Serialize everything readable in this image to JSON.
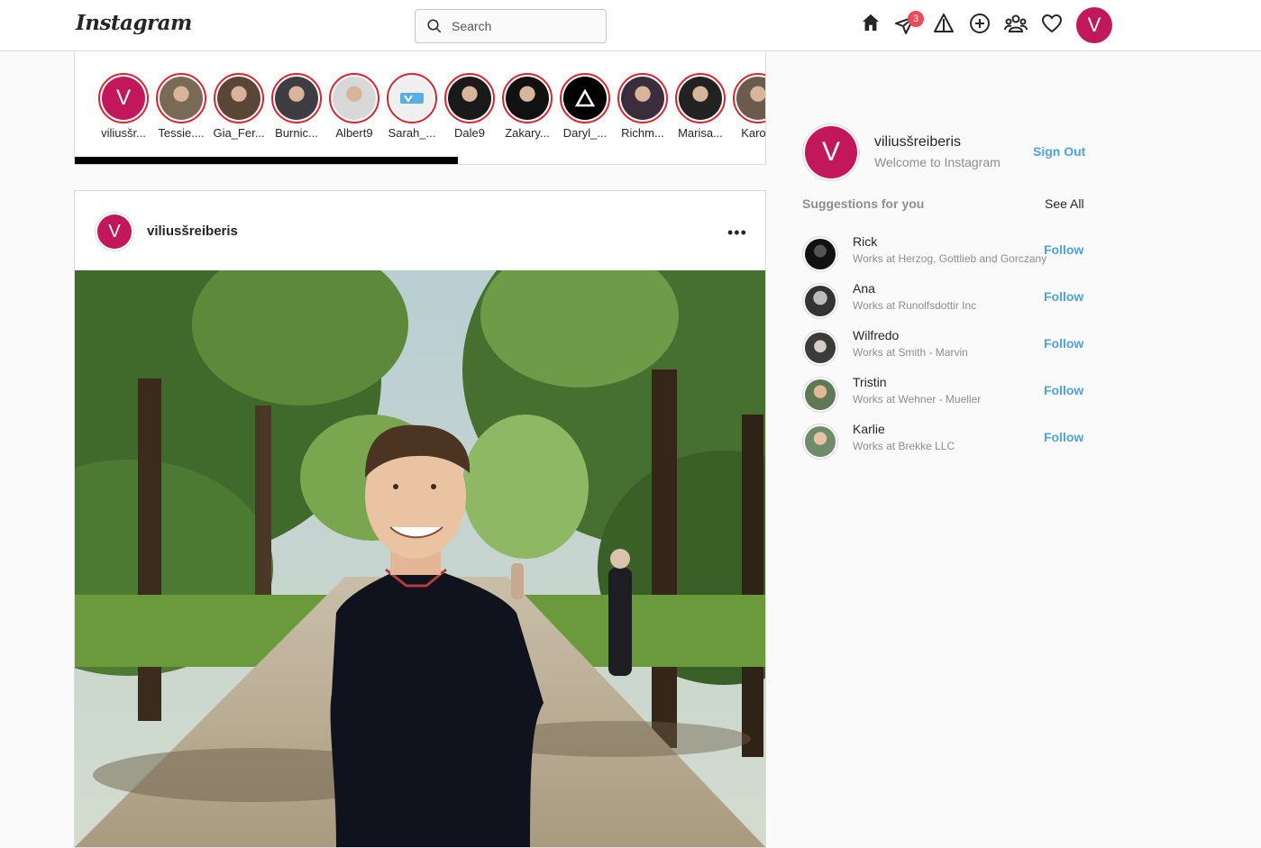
{
  "header": {
    "logo": "Instagram",
    "search_placeholder": "Search",
    "messages_badge": "3",
    "avatar_letter": "V",
    "brand_color": "#c2185b",
    "badge_color": "#ed4956"
  },
  "stories": [
    {
      "name": "viliusšr...",
      "kind": "letter",
      "letter": "V"
    },
    {
      "name": "Tessie....",
      "kind": "photo"
    },
    {
      "name": "Gia_Fer...",
      "kind": "photo"
    },
    {
      "name": "Burnic...",
      "kind": "photo"
    },
    {
      "name": "Albert9",
      "kind": "photo"
    },
    {
      "name": "Sarah_...",
      "kind": "logo"
    },
    {
      "name": "Dale9",
      "kind": "photo"
    },
    {
      "name": "Zakary...",
      "kind": "photo"
    },
    {
      "name": "Daryl_...",
      "kind": "triangle"
    },
    {
      "name": "Richm...",
      "kind": "photo"
    },
    {
      "name": "Marisa...",
      "kind": "photo"
    },
    {
      "name": "Karola",
      "kind": "photo"
    }
  ],
  "post": {
    "username": "viliusšreiberis",
    "avatar_letter": "V",
    "more": "•••"
  },
  "sidebar": {
    "name": "viliusšreiberis",
    "subtitle": "Welcome to Instagram",
    "avatar_letter": "V",
    "signout": "Sign Out",
    "suggestions_title": "Suggestions for you",
    "see_all": "See All",
    "suggestions": [
      {
        "name": "Rick",
        "sub": "Works at Herzog, Gottlieb and Gorczany",
        "follow": "Follow"
      },
      {
        "name": "Ana",
        "sub": "Works at Runolfsdottir Inc",
        "follow": "Follow"
      },
      {
        "name": "Wilfredo",
        "sub": "Works at Smith - Marvin",
        "follow": "Follow"
      },
      {
        "name": "Tristin",
        "sub": "Works at Wehner - Mueller",
        "follow": "Follow"
      },
      {
        "name": "Karlie",
        "sub": "Works at Brekke LLC",
        "follow": "Follow"
      }
    ]
  }
}
